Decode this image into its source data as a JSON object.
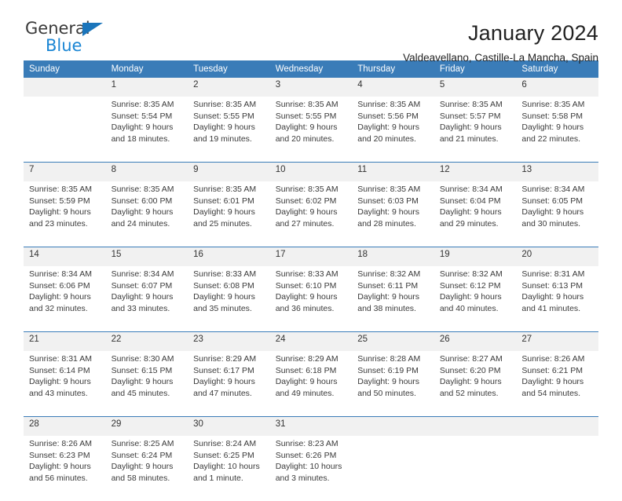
{
  "brand": {
    "name_part1": "General",
    "name_part2": "Blue",
    "logo_icon": "triangle-logo-icon",
    "color_primary": "#1b75bb",
    "color_secondary": "#1b86d4"
  },
  "header": {
    "title": "January 2024",
    "subtitle": "Valdeavellano, Castille-La Mancha, Spain"
  },
  "theme": {
    "header_bar": "#3a7cb8",
    "daynum_band": "#f1f1f1",
    "text": "#3a3a3a"
  },
  "calendar": {
    "weekday_headers": [
      "Sunday",
      "Monday",
      "Tuesday",
      "Wednesday",
      "Thursday",
      "Friday",
      "Saturday"
    ],
    "weeks": [
      [
        {
          "day": "",
          "lines": []
        },
        {
          "day": "1",
          "lines": [
            "Sunrise: 8:35 AM",
            "Sunset: 5:54 PM",
            "Daylight: 9 hours",
            "and 18 minutes."
          ]
        },
        {
          "day": "2",
          "lines": [
            "Sunrise: 8:35 AM",
            "Sunset: 5:55 PM",
            "Daylight: 9 hours",
            "and 19 minutes."
          ]
        },
        {
          "day": "3",
          "lines": [
            "Sunrise: 8:35 AM",
            "Sunset: 5:55 PM",
            "Daylight: 9 hours",
            "and 20 minutes."
          ]
        },
        {
          "day": "4",
          "lines": [
            "Sunrise: 8:35 AM",
            "Sunset: 5:56 PM",
            "Daylight: 9 hours",
            "and 20 minutes."
          ]
        },
        {
          "day": "5",
          "lines": [
            "Sunrise: 8:35 AM",
            "Sunset: 5:57 PM",
            "Daylight: 9 hours",
            "and 21 minutes."
          ]
        },
        {
          "day": "6",
          "lines": [
            "Sunrise: 8:35 AM",
            "Sunset: 5:58 PM",
            "Daylight: 9 hours",
            "and 22 minutes."
          ]
        }
      ],
      [
        {
          "day": "7",
          "lines": [
            "Sunrise: 8:35 AM",
            "Sunset: 5:59 PM",
            "Daylight: 9 hours",
            "and 23 minutes."
          ]
        },
        {
          "day": "8",
          "lines": [
            "Sunrise: 8:35 AM",
            "Sunset: 6:00 PM",
            "Daylight: 9 hours",
            "and 24 minutes."
          ]
        },
        {
          "day": "9",
          "lines": [
            "Sunrise: 8:35 AM",
            "Sunset: 6:01 PM",
            "Daylight: 9 hours",
            "and 25 minutes."
          ]
        },
        {
          "day": "10",
          "lines": [
            "Sunrise: 8:35 AM",
            "Sunset: 6:02 PM",
            "Daylight: 9 hours",
            "and 27 minutes."
          ]
        },
        {
          "day": "11",
          "lines": [
            "Sunrise: 8:35 AM",
            "Sunset: 6:03 PM",
            "Daylight: 9 hours",
            "and 28 minutes."
          ]
        },
        {
          "day": "12",
          "lines": [
            "Sunrise: 8:34 AM",
            "Sunset: 6:04 PM",
            "Daylight: 9 hours",
            "and 29 minutes."
          ]
        },
        {
          "day": "13",
          "lines": [
            "Sunrise: 8:34 AM",
            "Sunset: 6:05 PM",
            "Daylight: 9 hours",
            "and 30 minutes."
          ]
        }
      ],
      [
        {
          "day": "14",
          "lines": [
            "Sunrise: 8:34 AM",
            "Sunset: 6:06 PM",
            "Daylight: 9 hours",
            "and 32 minutes."
          ]
        },
        {
          "day": "15",
          "lines": [
            "Sunrise: 8:34 AM",
            "Sunset: 6:07 PM",
            "Daylight: 9 hours",
            "and 33 minutes."
          ]
        },
        {
          "day": "16",
          "lines": [
            "Sunrise: 8:33 AM",
            "Sunset: 6:08 PM",
            "Daylight: 9 hours",
            "and 35 minutes."
          ]
        },
        {
          "day": "17",
          "lines": [
            "Sunrise: 8:33 AM",
            "Sunset: 6:10 PM",
            "Daylight: 9 hours",
            "and 36 minutes."
          ]
        },
        {
          "day": "18",
          "lines": [
            "Sunrise: 8:32 AM",
            "Sunset: 6:11 PM",
            "Daylight: 9 hours",
            "and 38 minutes."
          ]
        },
        {
          "day": "19",
          "lines": [
            "Sunrise: 8:32 AM",
            "Sunset: 6:12 PM",
            "Daylight: 9 hours",
            "and 40 minutes."
          ]
        },
        {
          "day": "20",
          "lines": [
            "Sunrise: 8:31 AM",
            "Sunset: 6:13 PM",
            "Daylight: 9 hours",
            "and 41 minutes."
          ]
        }
      ],
      [
        {
          "day": "21",
          "lines": [
            "Sunrise: 8:31 AM",
            "Sunset: 6:14 PM",
            "Daylight: 9 hours",
            "and 43 minutes."
          ]
        },
        {
          "day": "22",
          "lines": [
            "Sunrise: 8:30 AM",
            "Sunset: 6:15 PM",
            "Daylight: 9 hours",
            "and 45 minutes."
          ]
        },
        {
          "day": "23",
          "lines": [
            "Sunrise: 8:29 AM",
            "Sunset: 6:17 PM",
            "Daylight: 9 hours",
            "and 47 minutes."
          ]
        },
        {
          "day": "24",
          "lines": [
            "Sunrise: 8:29 AM",
            "Sunset: 6:18 PM",
            "Daylight: 9 hours",
            "and 49 minutes."
          ]
        },
        {
          "day": "25",
          "lines": [
            "Sunrise: 8:28 AM",
            "Sunset: 6:19 PM",
            "Daylight: 9 hours",
            "and 50 minutes."
          ]
        },
        {
          "day": "26",
          "lines": [
            "Sunrise: 8:27 AM",
            "Sunset: 6:20 PM",
            "Daylight: 9 hours",
            "and 52 minutes."
          ]
        },
        {
          "day": "27",
          "lines": [
            "Sunrise: 8:26 AM",
            "Sunset: 6:21 PM",
            "Daylight: 9 hours",
            "and 54 minutes."
          ]
        }
      ],
      [
        {
          "day": "28",
          "lines": [
            "Sunrise: 8:26 AM",
            "Sunset: 6:23 PM",
            "Daylight: 9 hours",
            "and 56 minutes."
          ]
        },
        {
          "day": "29",
          "lines": [
            "Sunrise: 8:25 AM",
            "Sunset: 6:24 PM",
            "Daylight: 9 hours",
            "and 58 minutes."
          ]
        },
        {
          "day": "30",
          "lines": [
            "Sunrise: 8:24 AM",
            "Sunset: 6:25 PM",
            "Daylight: 10 hours",
            "and 1 minute."
          ]
        },
        {
          "day": "31",
          "lines": [
            "Sunrise: 8:23 AM",
            "Sunset: 6:26 PM",
            "Daylight: 10 hours",
            "and 3 minutes."
          ]
        },
        {
          "day": "",
          "lines": []
        },
        {
          "day": "",
          "lines": []
        },
        {
          "day": "",
          "lines": []
        }
      ]
    ]
  }
}
